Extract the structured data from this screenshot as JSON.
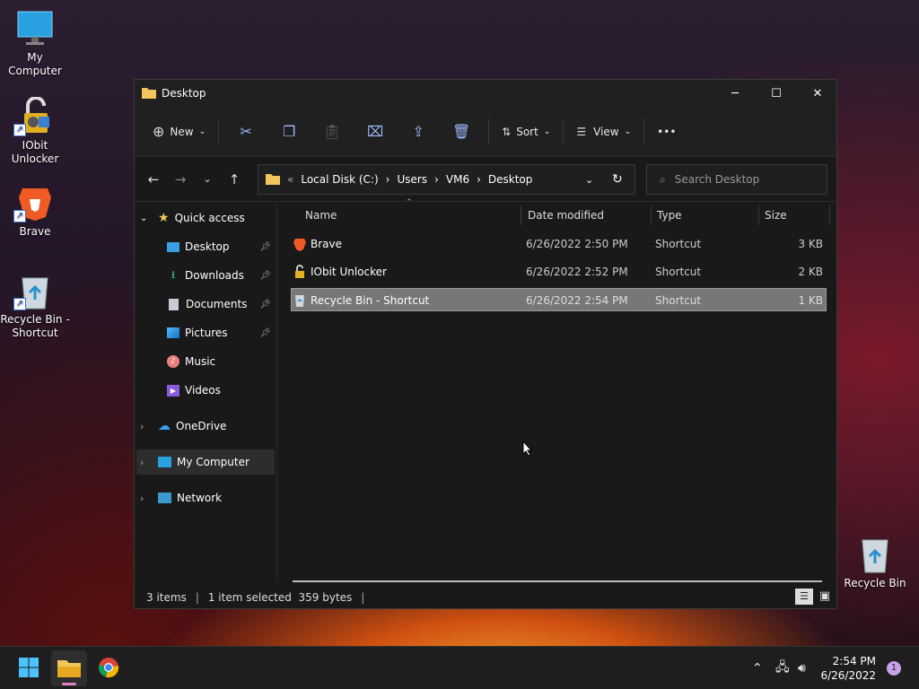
{
  "desktop": {
    "icons": [
      {
        "label": "My Computer",
        "icon": "monitor-icon"
      },
      {
        "label": "IObit Unlocker",
        "icon": "iobit-unlocker-icon"
      },
      {
        "label": "Brave",
        "icon": "brave-lion-icon"
      },
      {
        "label": "Recycle Bin - Shortcut",
        "icon": "recycle-bin-icon"
      },
      {
        "label": "Recycle Bin",
        "icon": "recycle-bin-icon"
      }
    ]
  },
  "window": {
    "title": "Desktop",
    "controls": {
      "minimize": "─",
      "maximize": "☐",
      "close": "✕"
    }
  },
  "toolbar": {
    "new_label": "New",
    "sort_label": "Sort",
    "view_label": "View",
    "more": "•••"
  },
  "address": {
    "overflow": "«",
    "segments": [
      "Local Disk (C:)",
      "Users",
      "VM6",
      "Desktop"
    ],
    "separator": "›",
    "search_placeholder": "Search Desktop"
  },
  "nav_pane": {
    "quick_access": "Quick access",
    "items": [
      {
        "label": "Desktop",
        "pinned": true
      },
      {
        "label": "Downloads",
        "pinned": true
      },
      {
        "label": "Documents",
        "pinned": true
      },
      {
        "label": "Pictures",
        "pinned": true
      },
      {
        "label": "Music",
        "pinned": false
      },
      {
        "label": "Videos",
        "pinned": false
      }
    ],
    "onedrive": "OneDrive",
    "my_computer": "My Computer",
    "network": "Network"
  },
  "columns": {
    "name": "Name",
    "date": "Date modified",
    "type": "Type",
    "size": "Size"
  },
  "files": [
    {
      "name": "Brave",
      "date": "6/26/2022 2:50 PM",
      "type": "Shortcut",
      "size": "3 KB"
    },
    {
      "name": "IObit Unlocker",
      "date": "6/26/2022 2:52 PM",
      "type": "Shortcut",
      "size": "2 KB"
    },
    {
      "name": "Recycle Bin - Shortcut",
      "date": "6/26/2022 2:54 PM",
      "type": "Shortcut",
      "size": "1 KB"
    }
  ],
  "status": {
    "count": "3 items",
    "selected": "1 item selected  359 bytes"
  },
  "taskbar": {
    "time": "2:54 PM",
    "date": "6/26/2022",
    "notifications": "1"
  },
  "colors": {
    "accent": "#4cc2ff",
    "folder": "#f2c55c",
    "selection": "#777777"
  }
}
